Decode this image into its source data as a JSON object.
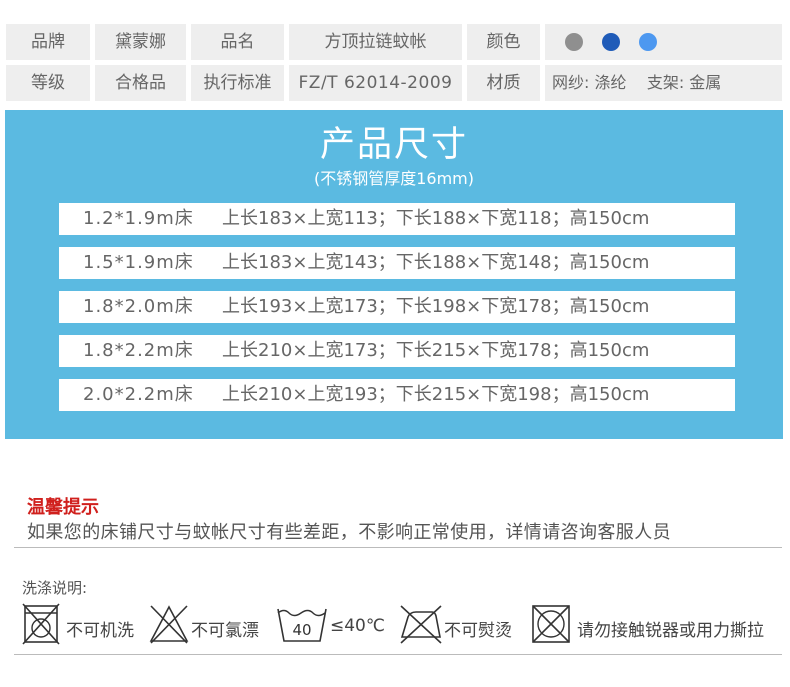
{
  "spec": {
    "row1": {
      "brand_label": "品牌",
      "brand_value": "黛蒙娜",
      "name_label": "品名",
      "name_value": "方顶拉链蚊帐",
      "color_label": "颜色",
      "colors": [
        "#8f8f8f",
        "#1f5bb8",
        "#4d98f0"
      ]
    },
    "row2": {
      "grade_label": "等级",
      "grade_value": "合格品",
      "standard_label": "执行标准",
      "standard_value": "FZ/T 62014-2009",
      "material_label": "材质",
      "material_value": "网纱: 涤纶    支架: 金属"
    }
  },
  "size_panel": {
    "title": "产品尺寸",
    "subtitle": "(不锈钢管厚度16mm)",
    "rows": [
      {
        "bed": "1.2*1.9m床",
        "dims": "上长183×上宽113；下长188×下宽118；高150cm"
      },
      {
        "bed": "1.5*1.9m床",
        "dims": "上长183×上宽143；下长188×下宽148；高150cm"
      },
      {
        "bed": "1.8*2.0m床",
        "dims": "上长193×上宽173；下长198×下宽178；高150cm"
      },
      {
        "bed": "1.8*2.2m床",
        "dims": "上长210×上宽173；下长215×下宽178；高150cm"
      },
      {
        "bed": "2.0*2.2m床",
        "dims": "上长210×上宽193；下长215×下宽198；高150cm"
      }
    ]
  },
  "tip": {
    "title": "温馨提示",
    "text": "如果您的床铺尺寸与蚊帐尺寸有些差距，不影响正常使用，详情请咨询客服人员"
  },
  "wash": {
    "title": "洗涤说明:",
    "items": [
      {
        "icon": "no-machine-wash-icon",
        "label": "不可机洗"
      },
      {
        "icon": "no-bleach-icon",
        "label": "不可氯漂"
      },
      {
        "icon": "wash-40-icon",
        "tub_number": "40",
        "label": "≤40℃"
      },
      {
        "icon": "no-iron-icon",
        "label": "不可熨烫"
      },
      {
        "icon": "no-tumble-dry-icon",
        "label": "请勿接触锐器或用力撕拉"
      }
    ]
  }
}
